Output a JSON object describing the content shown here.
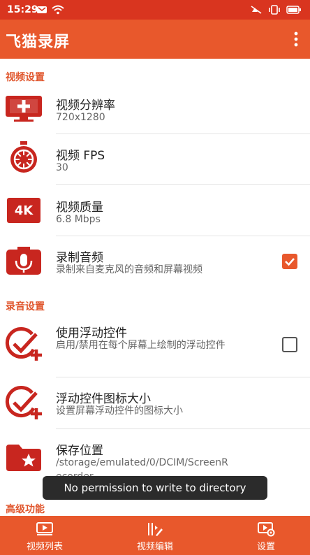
{
  "status": {
    "time": "15:29"
  },
  "app": {
    "title": "飞猫录屏"
  },
  "sections": {
    "video": "视频设置",
    "audio": "录音设置",
    "advanced": "高级功能"
  },
  "items": [
    {
      "title": "视频分辨率",
      "subtitle": "720x1280",
      "icon": "monitor-plus-icon"
    },
    {
      "title": "视频 FPS",
      "subtitle": "30",
      "icon": "stopwatch-icon"
    },
    {
      "title": "视频质量",
      "subtitle": "6.8 Mbps",
      "icon": "4k-icon"
    },
    {
      "title": "录制音频",
      "subtitle": "录制来自麦克风的音频和屏幕视频",
      "icon": "microphone-icon",
      "checked": true
    },
    {
      "title": "使用浮动控件",
      "subtitle": "启用/禁用在每个屏幕上绘制的浮动控件",
      "icon": "check-plus-icon",
      "checked": false
    },
    {
      "title": "浮动控件图标大小",
      "subtitle": "设置屏幕浮动控件的图标大小",
      "icon": "check-plus-icon"
    },
    {
      "title": "保存位置",
      "subtitle": "/storage/emulated/0/DCIM/ScreenRecorder",
      "icon": "folder-star-icon"
    }
  ],
  "icon_text": {
    "four_k": "4K"
  },
  "toast": "No permission to write to directory",
  "tabs": [
    {
      "label": "视频列表",
      "icon": "video-list-icon"
    },
    {
      "label": "视频编辑",
      "icon": "video-edit-icon"
    },
    {
      "label": "设置",
      "icon": "settings-icon"
    }
  ],
  "colors": {
    "accent": "#e8582c",
    "statusbar": "#d9351f",
    "icon_red": "#c8261f"
  }
}
